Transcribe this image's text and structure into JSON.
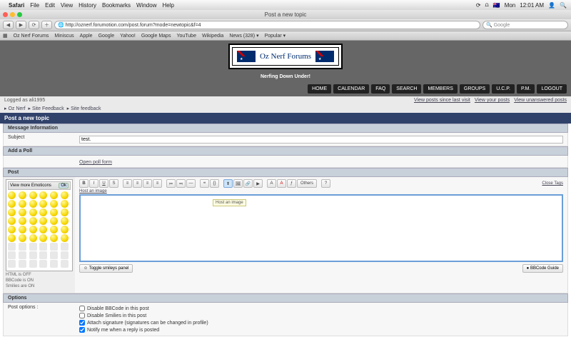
{
  "menubar": {
    "app": "Safari",
    "items": [
      "File",
      "Edit",
      "View",
      "History",
      "Bookmarks",
      "Window",
      "Help"
    ],
    "status": {
      "flag": "🇦🇺",
      "day": "Mon",
      "time": "12:01 AM"
    }
  },
  "window": {
    "title": "Post a new topic",
    "url": "http://oznerf.forumotion.com/post.forum?mode=newtopic&f=4",
    "search_placeholder": "Google"
  },
  "bookmarks": [
    "Oz Nerf Forums",
    "Miniscus",
    "Apple",
    "Google",
    "Yahoo!",
    "Google Maps",
    "YouTube",
    "Wikipedia",
    "News (328) ▾",
    "Popular ▾"
  ],
  "site": {
    "name": "Oz Nerf Forums",
    "tagline": "Nerfing Down Under!",
    "nav": [
      "HOME",
      "CALENDAR",
      "FAQ",
      "SEARCH",
      "MEMBERS",
      "GROUPS",
      "U.C.P.",
      "P.M.",
      "LOGOUT"
    ]
  },
  "user": {
    "logged_as": "Logged as ali1995",
    "links": [
      "View posts since last visit",
      "View your posts",
      "View unanswered posts"
    ]
  },
  "crumbs": [
    "Oz Nerf",
    "Site Feedback",
    "Site feedback"
  ],
  "post": {
    "heading": "Post a new topic",
    "msginfo": "Message Information",
    "subject_label": "Subject",
    "subject_value": "test.",
    "addpoll": "Add a Poll",
    "openpoll": "Open poll form",
    "post_label": "Post",
    "options_heading": "Options",
    "postoptions_label": "Post options :"
  },
  "smileys": {
    "header": "View more Emoticons",
    "ok": "Ok",
    "notes": [
      "HTML is OFF",
      "BBCode is ON",
      "Smilies are ON"
    ]
  },
  "editor": {
    "host_label": "Host an image",
    "tooltip": "Host an image",
    "others_label": "Others",
    "close_tags": "Close Tags",
    "toggle_smileys": "Toggle smileys panel",
    "bbcode_guide": "BBCode Guide"
  },
  "options": [
    {
      "checked": false,
      "label": "Disable BBCode in this post"
    },
    {
      "checked": false,
      "label": "Disable Smilies in this post"
    },
    {
      "checked": true,
      "label": "Attach signature (signatures can be changed in profile)"
    },
    {
      "checked": true,
      "label": "Notify me when a reply is posted"
    }
  ]
}
